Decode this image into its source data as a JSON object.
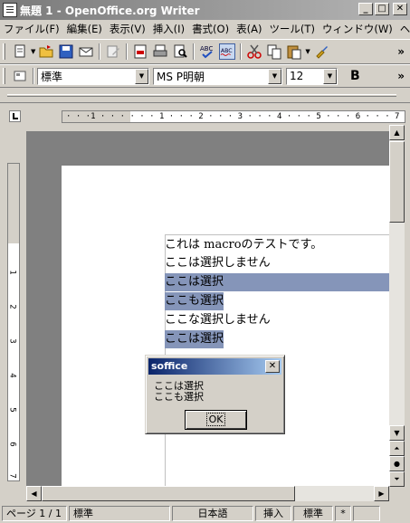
{
  "window": {
    "title": "無題 1 - OpenOffice.org Writer"
  },
  "menu": [
    "ファイル(F)",
    "編集(E)",
    "表示(V)",
    "挿入(I)",
    "書式(O)",
    "表(A)",
    "ツール(T)",
    "ウィンドウ(W)",
    "ヘ"
  ],
  "format": {
    "style": "標準",
    "font": "MS P明朝",
    "size": "12",
    "bold_label": "B"
  },
  "ruler": {
    "h_ticks": "· · ·1 · · ·  · · · 1 · · · 2 · · · 3 · · · 4 · · · 5 · · · 6 · · · 7 ·",
    "v_numbers": [
      "1",
      "2",
      "3",
      "4",
      "5",
      "6",
      "7"
    ]
  },
  "document": {
    "lines": [
      {
        "text": "これは macroのテストです。",
        "selected": false
      },
      {
        "text": "ここは選択しません",
        "selected": false
      },
      {
        "text": "ここは選択",
        "selected": true
      },
      {
        "text": "ここも選択",
        "selected": true
      },
      {
        "text": "ここな選択しません",
        "selected": false
      },
      {
        "text": "ここは選択",
        "selected": true
      }
    ]
  },
  "dialog": {
    "title": "soffice",
    "message_line1": "ここは選択",
    "message_line2": "ここも選択",
    "ok_label": "OK"
  },
  "status": {
    "page": "ページ 1 / 1",
    "style": "標準",
    "language": "日本語",
    "insert_mode": "挿入",
    "selection_mode": "標準",
    "modified": "*"
  },
  "colors": {
    "selection": "#8595b9",
    "dialog_title": "#0a246a"
  }
}
